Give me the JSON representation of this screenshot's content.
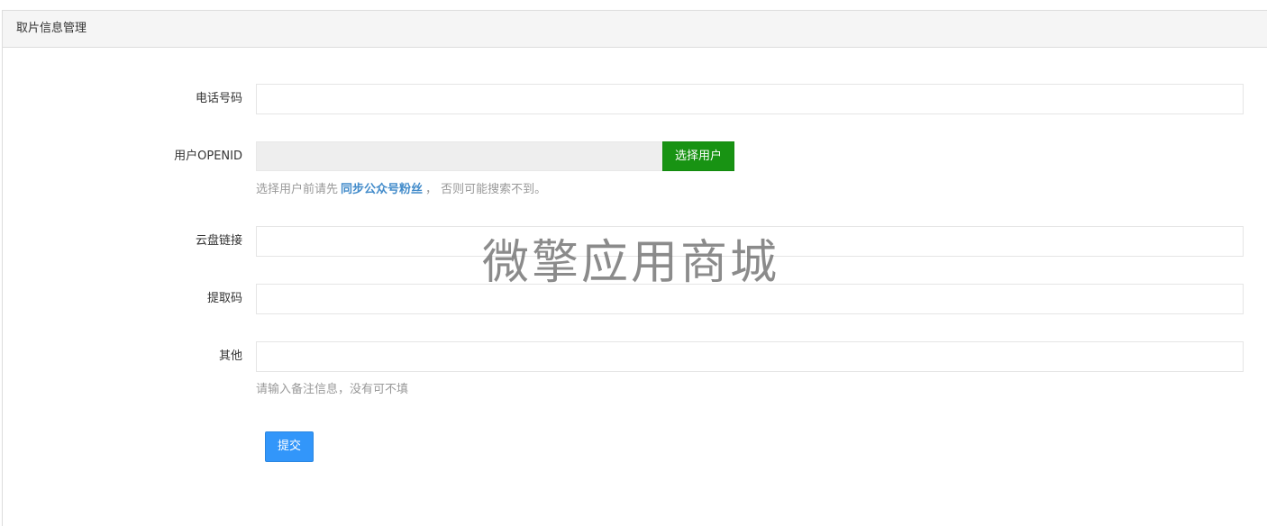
{
  "panel": {
    "title": "取片信息管理"
  },
  "form": {
    "phone": {
      "label": "电话号码",
      "value": "",
      "placeholder": ""
    },
    "openid": {
      "label": "用户OPENID",
      "value": "",
      "select_button": "选择用户",
      "help_prefix": "选择用户前请先",
      "help_link": "同步公众号粉丝",
      "help_suffix": "， 否则可能搜索不到。"
    },
    "cloud_link": {
      "label": "云盘链接",
      "value": ""
    },
    "extract_code": {
      "label": "提取码",
      "value": ""
    },
    "other": {
      "label": "其他",
      "value": "",
      "help": "请输入备注信息，没有可不填"
    },
    "submit_label": "提交"
  },
  "watermark": "微擎应用商城",
  "colors": {
    "select_button": "#189313",
    "submit_button": "#3296fa",
    "link": "#428bca",
    "heading_bg": "#f5f5f5"
  }
}
